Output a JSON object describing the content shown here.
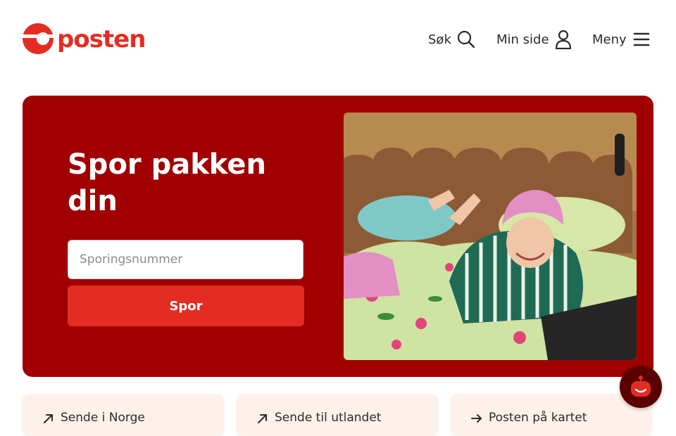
{
  "header": {
    "logo_text": "posten",
    "nav": {
      "search_label": "Søk",
      "mypage_label": "Min side",
      "menu_label": "Meny"
    }
  },
  "hero": {
    "title": "Spor pakken din",
    "tracking_placeholder": "Sporingsnummer",
    "track_button_label": "Spor"
  },
  "quick_links": [
    {
      "label": "Sende i Norge",
      "icon": "arrow-up-right-icon"
    },
    {
      "label": "Sende til utlandet",
      "icon": "arrow-up-right-icon"
    },
    {
      "label": "Posten på kartet",
      "icon": "arrow-right-icon"
    }
  ],
  "colors": {
    "brand_red": "#e32d22",
    "hero_bg": "#a00000",
    "chat_bg": "#5a0000"
  }
}
